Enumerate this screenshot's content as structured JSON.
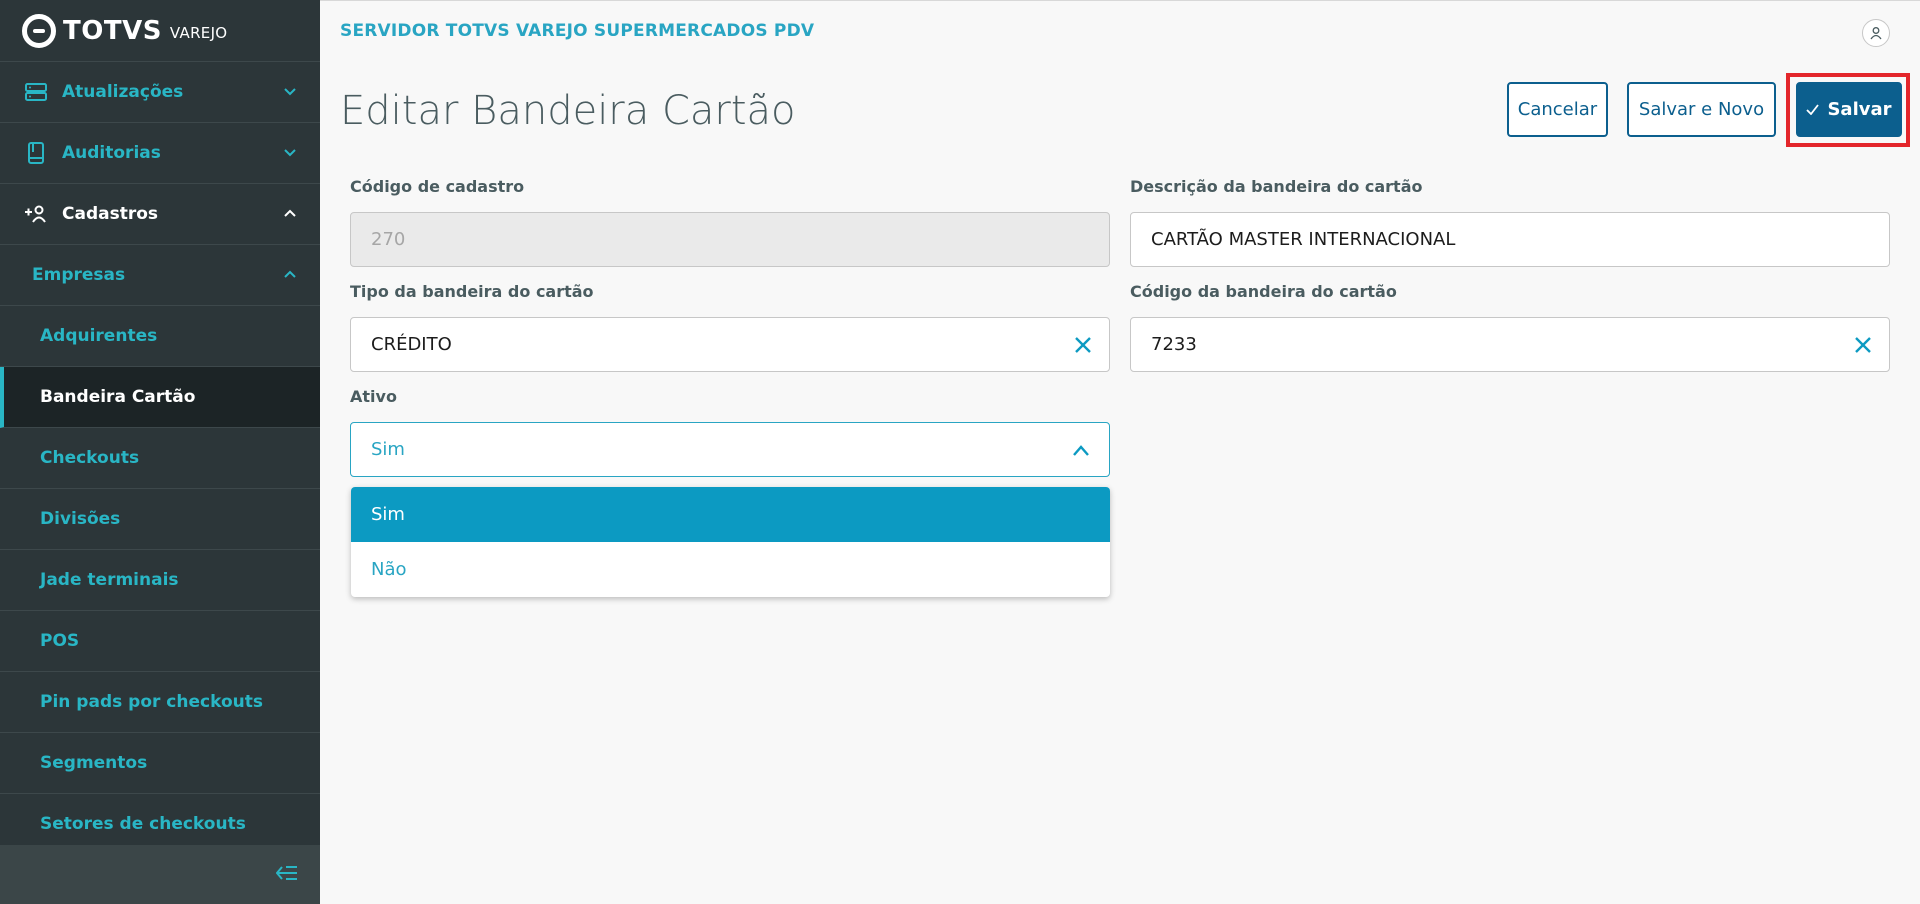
{
  "brand": {
    "logo_text": "TOTVS",
    "logo_sub": "VAREJO"
  },
  "header": {
    "server_title": "SERVIDOR TOTVS VAREJO SUPERMERCADOS PDV"
  },
  "page": {
    "title": "Editar Bandeira Cartão"
  },
  "actions": {
    "cancel": "Cancelar",
    "save_new": "Salvar e Novo",
    "save": "Salvar"
  },
  "sidebar": {
    "items": [
      {
        "label": "Atualizações",
        "icon": "server-icon"
      },
      {
        "label": "Auditorias",
        "icon": "book-icon"
      },
      {
        "label": "Cadastros",
        "icon": "add-user-icon"
      },
      {
        "label": "Empresas"
      },
      {
        "label": "Adquirentes"
      },
      {
        "label": "Bandeira Cartão"
      },
      {
        "label": "Checkouts"
      },
      {
        "label": "Divisões"
      },
      {
        "label": "Jade terminais"
      },
      {
        "label": "POS"
      },
      {
        "label": "Pin pads por checkouts"
      },
      {
        "label": "Segmentos"
      },
      {
        "label": "Setores de checkouts"
      }
    ]
  },
  "form": {
    "codigo_cadastro": {
      "label": "Código de cadastro",
      "value": "270"
    },
    "descricao": {
      "label": "Descrição da bandeira do cartão",
      "value": "CARTÃO MASTER INTERNACIONAL"
    },
    "tipo": {
      "label": "Tipo da bandeira do cartão",
      "value": "CRÉDITO"
    },
    "codigo_bandeira": {
      "label": "Código da bandeira do cartão",
      "value": "7233"
    },
    "ativo": {
      "label": "Ativo",
      "value": "Sim",
      "options": [
        "Sim",
        "Não"
      ]
    }
  },
  "colors": {
    "accent": "#29b6c5",
    "primary": "#0c5f8e",
    "highlight": "#e3262b",
    "sidebar_bg": "#2c3639"
  }
}
